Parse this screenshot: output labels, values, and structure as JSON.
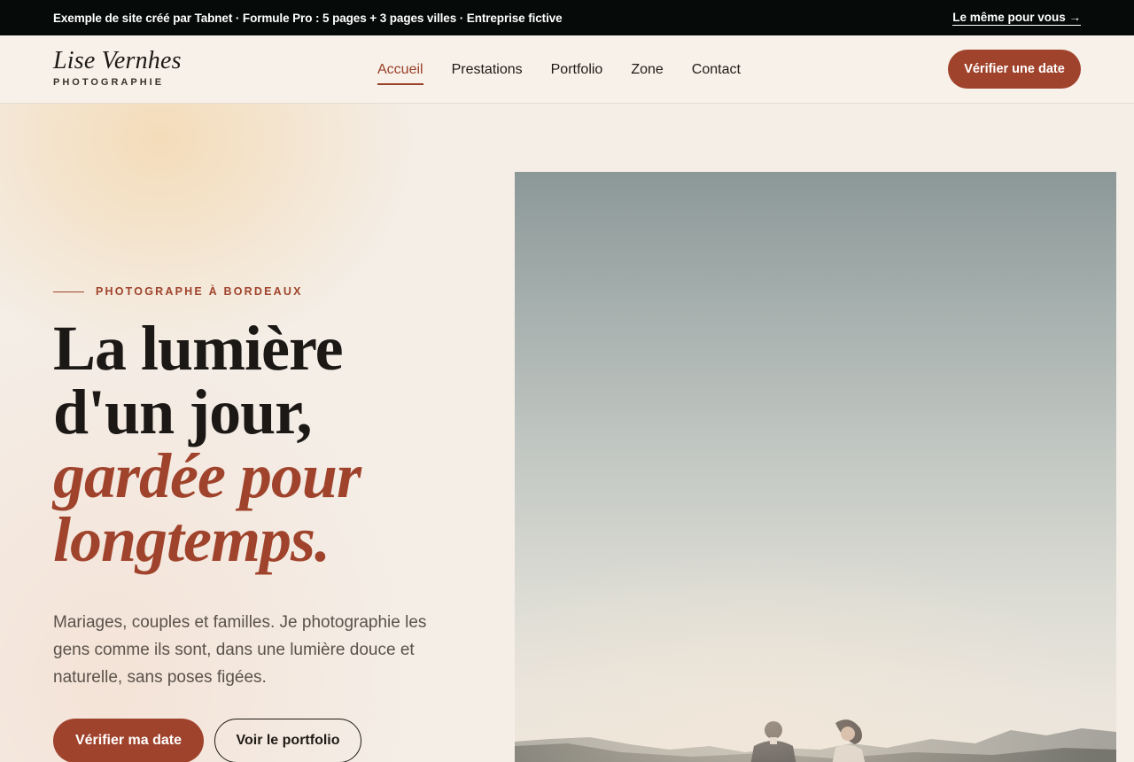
{
  "topbar": {
    "note": "Exemple de site créé par Tabnet · Formule Pro : 5 pages + 3 pages villes · Entreprise fictive",
    "cta": "Le même pour vous →"
  },
  "header": {
    "logo_name": "Lise Vernhes",
    "logo_sub": "PHOTOGRAPHIE",
    "nav": [
      "Accueil",
      "Prestations",
      "Portfolio",
      "Zone",
      "Contact"
    ],
    "active_nav": "Accueil",
    "cta": "Vérifier une date"
  },
  "hero": {
    "eyebrow": "PHOTOGRAPHE À BORDEAUX",
    "headline": [
      "La lumière",
      "d'un jour,"
    ],
    "headline_accent": [
      "gardée pour",
      "longtemps."
    ],
    "lead": "Mariages, couples et familles. Je photographie les gens comme ils sont, dans une lumière douce et naturelle, sans poses figées.",
    "primary_button": "Vérifier ma date",
    "secondary_button": "Voir le portfolio"
  },
  "colors": {
    "accent": "#a0432c",
    "topbar_bg": "#060a09",
    "page_bg": "#f5efe8"
  }
}
